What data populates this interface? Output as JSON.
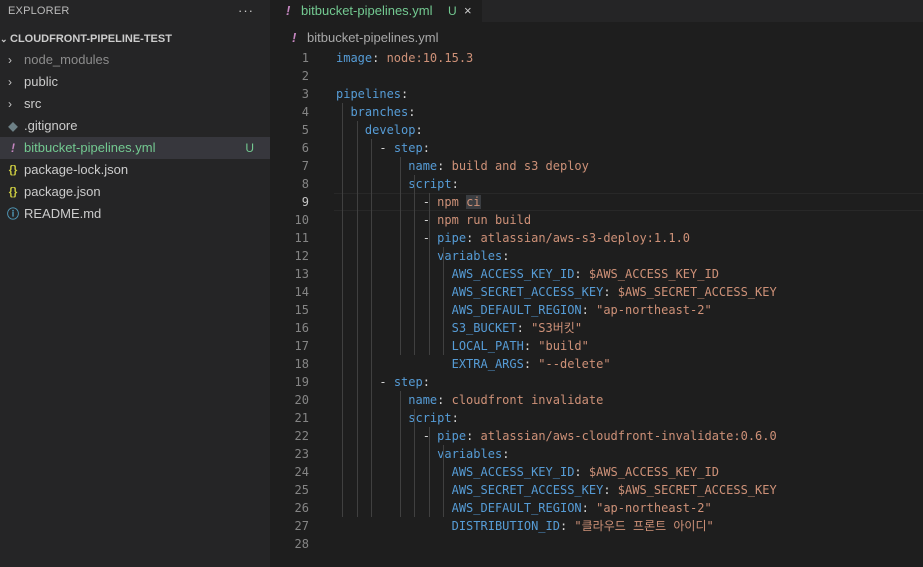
{
  "explorer": {
    "header": "EXPLORER",
    "more": "···",
    "section_title": "CLOUDFRONT-PIPELINE-TEST",
    "items": [
      {
        "label": "node_modules",
        "kind": "folder",
        "dim": true
      },
      {
        "label": "public",
        "kind": "folder"
      },
      {
        "label": "src",
        "kind": "folder"
      },
      {
        "label": ".gitignore",
        "kind": "git"
      },
      {
        "label": "bitbucket-pipelines.yml",
        "kind": "yml",
        "selected": true,
        "status": "U"
      },
      {
        "label": "package-lock.json",
        "kind": "json"
      },
      {
        "label": "package.json",
        "kind": "json"
      },
      {
        "label": "README.md",
        "kind": "info"
      }
    ],
    "icons": {
      "folder": "›",
      "git": "◆",
      "yml": "!",
      "json": "{}",
      "info": "ⓘ"
    }
  },
  "tab": {
    "label": "bitbucket-pipelines.yml",
    "badge": "U",
    "close": "×",
    "icon": "!"
  },
  "breadcrumb": {
    "icon": "!",
    "label": "bitbucket-pipelines.yml"
  },
  "editor": {
    "current_line": 9,
    "lines": [
      [
        [
          "k",
          "image"
        ],
        [
          "p",
          ": "
        ],
        [
          "v",
          "node:10.15.3"
        ]
      ],
      [],
      [
        [
          "k",
          "pipelines"
        ],
        [
          "p",
          ":"
        ]
      ],
      [
        [
          "p",
          "  "
        ],
        [
          "k",
          "branches"
        ],
        [
          "p",
          ":"
        ]
      ],
      [
        [
          "p",
          "    "
        ],
        [
          "k",
          "develop"
        ],
        [
          "p",
          ":"
        ]
      ],
      [
        [
          "p",
          "      "
        ],
        [
          "p",
          "- "
        ],
        [
          "k",
          "step"
        ],
        [
          "p",
          ":"
        ]
      ],
      [
        [
          "p",
          "          "
        ],
        [
          "k",
          "name"
        ],
        [
          "p",
          ": "
        ],
        [
          "v",
          "build and s3 deploy"
        ]
      ],
      [
        [
          "p",
          "          "
        ],
        [
          "k",
          "script"
        ],
        [
          "p",
          ":"
        ]
      ],
      [
        [
          "p",
          "            "
        ],
        [
          "p",
          "- "
        ],
        [
          "v",
          "npm "
        ],
        [
          "vh",
          "ci"
        ]
      ],
      [
        [
          "p",
          "            "
        ],
        [
          "p",
          "- "
        ],
        [
          "v",
          "npm run build"
        ]
      ],
      [
        [
          "p",
          "            "
        ],
        [
          "p",
          "- "
        ],
        [
          "k",
          "pipe"
        ],
        [
          "p",
          ": "
        ],
        [
          "v",
          "atlassian/aws-s3-deploy:1.1.0"
        ]
      ],
      [
        [
          "p",
          "              "
        ],
        [
          "k",
          "variables"
        ],
        [
          "p",
          ":"
        ]
      ],
      [
        [
          "p",
          "                "
        ],
        [
          "k",
          "AWS_ACCESS_KEY_ID"
        ],
        [
          "p",
          ": "
        ],
        [
          "v",
          "$AWS_ACCESS_KEY_ID"
        ]
      ],
      [
        [
          "p",
          "                "
        ],
        [
          "k",
          "AWS_SECRET_ACCESS_KEY"
        ],
        [
          "p",
          ": "
        ],
        [
          "v",
          "$AWS_SECRET_ACCESS_KEY"
        ]
      ],
      [
        [
          "p",
          "                "
        ],
        [
          "k",
          "AWS_DEFAULT_REGION"
        ],
        [
          "p",
          ": "
        ],
        [
          "v",
          "\"ap-northeast-2\""
        ]
      ],
      [
        [
          "p",
          "                "
        ],
        [
          "k",
          "S3_BUCKET"
        ],
        [
          "p",
          ": "
        ],
        [
          "v",
          "\"S3버킷\""
        ]
      ],
      [
        [
          "p",
          "                "
        ],
        [
          "k",
          "LOCAL_PATH"
        ],
        [
          "p",
          ": "
        ],
        [
          "v",
          "\"build\""
        ]
      ],
      [
        [
          "p",
          "                "
        ],
        [
          "k",
          "EXTRA_ARGS"
        ],
        [
          "p",
          ": "
        ],
        [
          "v",
          "\"--delete\""
        ]
      ],
      [
        [
          "p",
          "      "
        ],
        [
          "p",
          "- "
        ],
        [
          "k",
          "step"
        ],
        [
          "p",
          ":"
        ]
      ],
      [
        [
          "p",
          "          "
        ],
        [
          "k",
          "name"
        ],
        [
          "p",
          ": "
        ],
        [
          "v",
          "cloudfront invalidate"
        ]
      ],
      [
        [
          "p",
          "          "
        ],
        [
          "k",
          "script"
        ],
        [
          "p",
          ":"
        ]
      ],
      [
        [
          "p",
          "            "
        ],
        [
          "p",
          "- "
        ],
        [
          "k",
          "pipe"
        ],
        [
          "p",
          ": "
        ],
        [
          "v",
          "atlassian/aws-cloudfront-invalidate:0.6.0"
        ]
      ],
      [
        [
          "p",
          "              "
        ],
        [
          "k",
          "variables"
        ],
        [
          "p",
          ":"
        ]
      ],
      [
        [
          "p",
          "                "
        ],
        [
          "k",
          "AWS_ACCESS_KEY_ID"
        ],
        [
          "p",
          ": "
        ],
        [
          "v",
          "$AWS_ACCESS_KEY_ID"
        ]
      ],
      [
        [
          "p",
          "                "
        ],
        [
          "k",
          "AWS_SECRET_ACCESS_KEY"
        ],
        [
          "p",
          ": "
        ],
        [
          "v",
          "$AWS_SECRET_ACCESS_KEY"
        ]
      ],
      [
        [
          "p",
          "                "
        ],
        [
          "k",
          "AWS_DEFAULT_REGION"
        ],
        [
          "p",
          ": "
        ],
        [
          "v",
          "\"ap-northeast-2\""
        ]
      ],
      [
        [
          "p",
          "                "
        ],
        [
          "k",
          "DISTRIBUTION_ID"
        ],
        [
          "p",
          ": "
        ],
        [
          "v",
          "\"클라우드 프론트 아이디\""
        ]
      ],
      []
    ]
  },
  "colors": {
    "key": "#569cd6",
    "value": "#ce9178",
    "untracked": "#73c991",
    "yaml_icon": "#c586c0",
    "json_icon": "#cbcb41",
    "info_icon": "#519aba"
  }
}
